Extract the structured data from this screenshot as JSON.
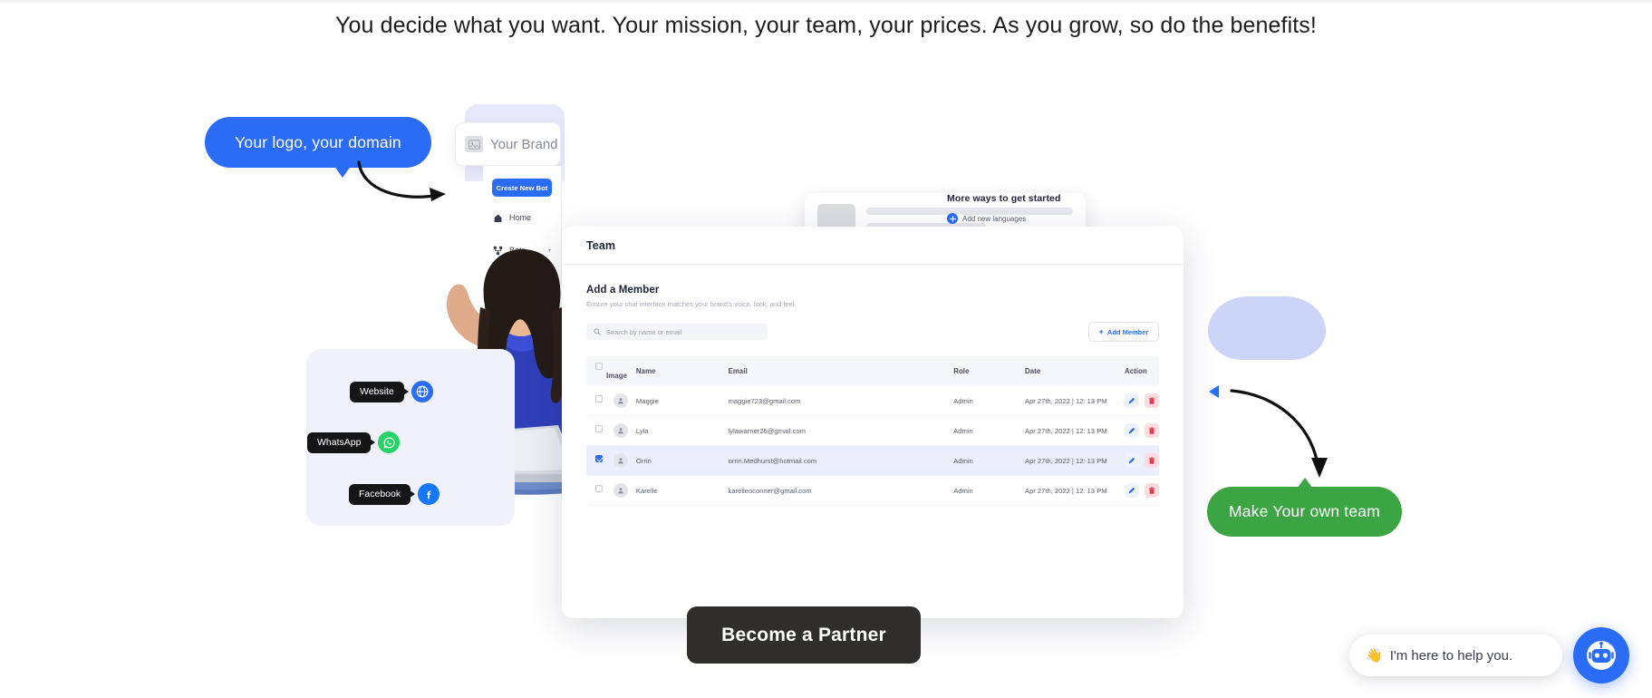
{
  "headline": "You decide what you want. Your mission, your team, your prices. As you grow, so do the benefits!",
  "callouts": {
    "left_bubble": "Your logo, your domain",
    "right_bubble": "Make Your own team"
  },
  "brand_card": {
    "label": "Your Brand",
    "icon": "image-placeholder-icon"
  },
  "sidebar": {
    "create_button": "Create New Bot",
    "items": [
      {
        "label": "Home",
        "icon": "home-icon",
        "has_caret": false
      },
      {
        "label": "Bots",
        "icon": "bots-icon",
        "has_caret": true
      }
    ]
  },
  "languages_card": {
    "title": "More ways to get started",
    "action": "Add new languages",
    "action_icon": "add-language-icon"
  },
  "app": {
    "title": "Team",
    "section_title": "Add a Member",
    "section_subtitle": "Ensure your chat interface matches your brand's voice, look, and feel.",
    "search_placeholder": "Search by name or email",
    "search_icon": "search-icon",
    "add_member_button": "Add Member",
    "add_member_icon": "plus-icon",
    "table": {
      "columns": [
        "Image",
        "Name",
        "Email",
        "Role",
        "Date",
        "Action"
      ],
      "rows": [
        {
          "checked": false,
          "name": "Maggie",
          "email": "maggie723@gmail.com",
          "role": "Admin",
          "date": "Apr 27th, 2022 | 12: 13 PM"
        },
        {
          "checked": false,
          "name": "Lyla",
          "email": "lylawarner26@gmail.com",
          "role": "Admin",
          "date": "Apr 27th, 2022 | 12: 13 PM"
        },
        {
          "checked": true,
          "name": "Orrin",
          "email": "orrin.Medhurst@hotmail.com",
          "role": "Admin",
          "date": "Apr 27th, 2022 | 12: 13 PM"
        },
        {
          "checked": false,
          "name": "Karelle",
          "email": "karelleoconner@gmail.com",
          "role": "Admin",
          "date": "Apr 27th, 2022 | 12: 13 PM"
        }
      ],
      "row_actions": {
        "edit_icon": "edit-pencil-icon",
        "delete_icon": "trash-icon"
      }
    }
  },
  "channels": [
    {
      "label": "Website",
      "icon": "globe-icon"
    },
    {
      "label": "WhatsApp",
      "icon": "whatsapp-icon"
    },
    {
      "label": "Facebook",
      "icon": "facebook-icon"
    }
  ],
  "cta_button": "Become a Partner",
  "chat_widget": {
    "message": "I'm here to help you.",
    "wave_emoji": "👋",
    "fab_icon": "chat-bot-icon"
  },
  "colors": {
    "blue": "#2a6cf5",
    "green": "#3ba544",
    "purple": "#6d3fd4",
    "dark": "#2f2e2c",
    "selected_row": "#eceefb",
    "delete_red": "#e23b4e"
  }
}
